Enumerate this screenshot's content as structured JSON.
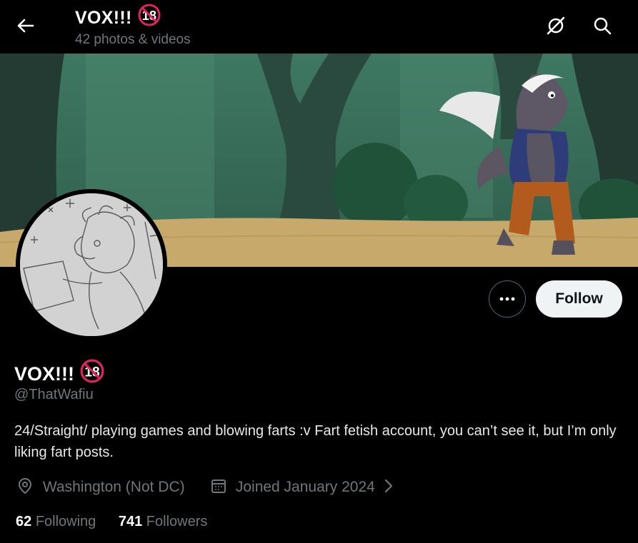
{
  "header": {
    "title": "VOX!!!",
    "age_badge": "18",
    "subtitle": "42 photos & videos"
  },
  "icons": {
    "back": "arrow-left-icon",
    "grok": "grok-icon",
    "search": "search-icon",
    "more": "more-icon",
    "location": "location-pin-icon",
    "calendar": "calendar-icon",
    "chevron": "chevron-right-icon"
  },
  "profile": {
    "display_name": "VOX!!!",
    "age_badge": "18",
    "handle": "@ThatWafiu",
    "bio": "24/Straight/ playing games and blowing farts :v Fart fetish account, you can’t see it, but I’m only liking fart posts.",
    "location": "Washington (Not DC)",
    "joined": "Joined January 2024",
    "following_count": "62",
    "following_label": "Following",
    "followers_count": "741",
    "followers_label": "Followers"
  },
  "actions": {
    "follow_label": "Follow"
  },
  "colors": {
    "background": "#000000",
    "text_primary": "#e7e9ea",
    "text_secondary": "#71767b",
    "follow_bg": "#eff3f4",
    "badge_red": "#e0245e"
  }
}
